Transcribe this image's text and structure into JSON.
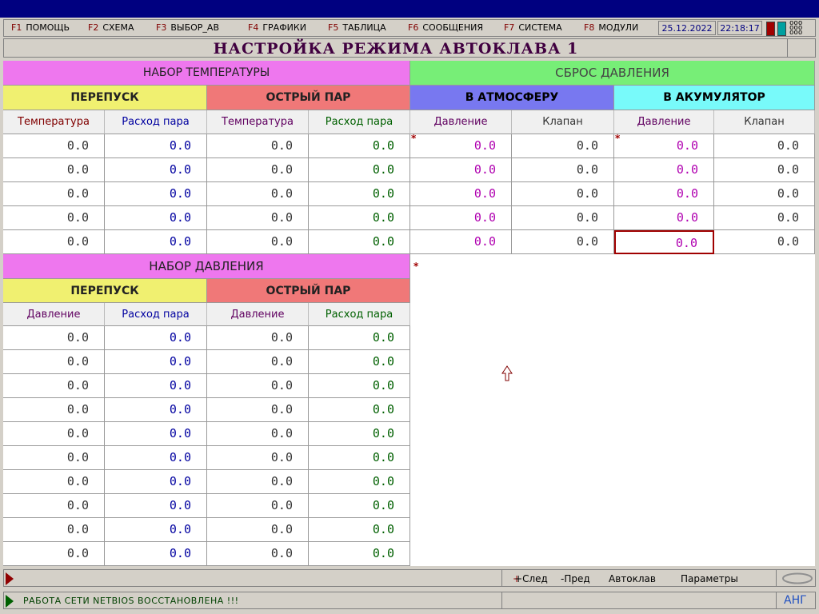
{
  "menu": [
    {
      "key": "F1",
      "label": "ПОМОЩЬ"
    },
    {
      "key": "F2",
      "label": "СХЕМА"
    },
    {
      "key": "F3",
      "label": "ВЫБОР_АВ"
    },
    {
      "key": "F4",
      "label": "ГРАФИКИ"
    },
    {
      "key": "F5",
      "label": "ТАБЛИЦА"
    },
    {
      "key": "F6",
      "label": "СООБЩЕНИЯ"
    },
    {
      "key": "F7",
      "label": "СИСТЕМА"
    },
    {
      "key": "F8",
      "label": "МОДУЛИ"
    }
  ],
  "date": "25.12.2022",
  "time": "22:18:17",
  "ooo": "ooo",
  "page_title": "НАСТРОЙКА РЕЖИМА АВТОКЛАВА 1",
  "temp_set": {
    "title": "НАБОР ТЕМПЕРАТУРЫ",
    "bypass": {
      "title": "ПЕРЕПУСК",
      "cols": [
        "Температура",
        "Расход пара"
      ],
      "rows": [
        [
          "0.0",
          "0.0"
        ],
        [
          "0.0",
          "0.0"
        ],
        [
          "0.0",
          "0.0"
        ],
        [
          "0.0",
          "0.0"
        ],
        [
          "0.0",
          "0.0"
        ]
      ]
    },
    "live_steam": {
      "title": "ОСТРЫЙ ПАР",
      "cols": [
        "Температура",
        "Расход пара"
      ],
      "rows": [
        [
          "0.0",
          "0.0"
        ],
        [
          "0.0",
          "0.0"
        ],
        [
          "0.0",
          "0.0"
        ],
        [
          "0.0",
          "0.0"
        ],
        [
          "0.0",
          "0.0"
        ]
      ]
    }
  },
  "pressure_release": {
    "title": "СБРОС ДАВЛЕНИЯ",
    "atmosphere": {
      "title": "В АТМОСФЕРУ",
      "cols": [
        "Давление",
        "Клапан"
      ],
      "rows": [
        [
          "0.0",
          "0.0"
        ],
        [
          "0.0",
          "0.0"
        ],
        [
          "0.0",
          "0.0"
        ],
        [
          "0.0",
          "0.0"
        ],
        [
          "0.0",
          "0.0"
        ]
      ]
    },
    "accumulator": {
      "title": "В АКУМУЛЯТОР",
      "cols": [
        "Давление",
        "Клапан"
      ],
      "rows": [
        [
          "0.0",
          "0.0"
        ],
        [
          "0.0",
          "0.0"
        ],
        [
          "0.0",
          "0.0"
        ],
        [
          "0.0",
          "0.0"
        ],
        [
          "0.0",
          "0.0"
        ]
      ]
    }
  },
  "pressure_set": {
    "title": "НАБОР ДАВЛЕНИЯ",
    "bypass": {
      "title": "ПЕРЕПУСК",
      "cols": [
        "Давление",
        "Расход пара"
      ],
      "rows": [
        [
          "0.0",
          "0.0"
        ],
        [
          "0.0",
          "0.0"
        ],
        [
          "0.0",
          "0.0"
        ],
        [
          "0.0",
          "0.0"
        ],
        [
          "0.0",
          "0.0"
        ],
        [
          "0.0",
          "0.0"
        ],
        [
          "0.0",
          "0.0"
        ],
        [
          "0.0",
          "0.0"
        ],
        [
          "0.0",
          "0.0"
        ],
        [
          "0.0",
          "0.0"
        ]
      ]
    },
    "live_steam": {
      "title": "ОСТРЫЙ ПАР",
      "cols": [
        "Давление",
        "Расход пара"
      ],
      "rows": [
        [
          "0.0",
          "0.0"
        ],
        [
          "0.0",
          "0.0"
        ],
        [
          "0.0",
          "0.0"
        ],
        [
          "0.0",
          "0.0"
        ],
        [
          "0.0",
          "0.0"
        ],
        [
          "0.0",
          "0.0"
        ],
        [
          "0.0",
          "0.0"
        ],
        [
          "0.0",
          "0.0"
        ],
        [
          "0.0",
          "0.0"
        ],
        [
          "0.0",
          "0.0"
        ]
      ]
    }
  },
  "markers": {
    "star": "*"
  },
  "nav": {
    "next": "+След",
    "prev": "-Пред",
    "autoclave": "Автоклав",
    "params": "Параметры"
  },
  "status_message": "РАБОТА СЕТИ NETBIOS ВОССТАНОВЛЕНА !!!",
  "lang": "АНГ",
  "colors": {
    "title_bar": "#000080",
    "temp_header": "#ee77ee",
    "release_header": "#77ee77",
    "bypass_header": "#f0f070",
    "steam_header": "#f07878",
    "atmosphere_header": "#7878f0",
    "accumulator_header": "#78fafa"
  }
}
